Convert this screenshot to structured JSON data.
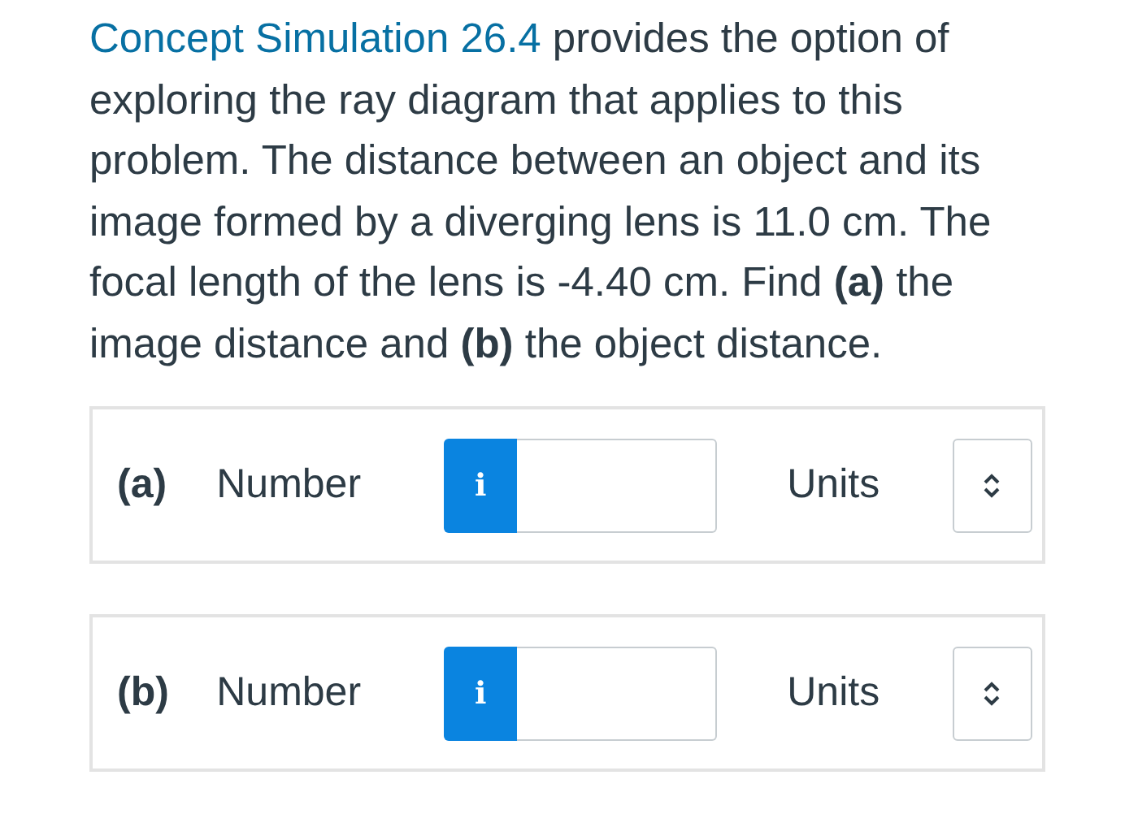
{
  "problem": {
    "link": "Concept Simulation 26.4",
    "text": " provides the option of exploring the ray diagram that applies to this problem. The distance between an object and its image formed by a diverging lens is 11.0 cm. The focal length of the lens is -4.40 cm. Find **(a)** the image distance and **(b)** the object distance."
  },
  "answers": [
    {
      "part": "(a)",
      "field_label": "Number",
      "info": "i",
      "units_label": "Units"
    },
    {
      "part": "(b)",
      "field_label": "Number",
      "info": "i",
      "units_label": "Units"
    }
  ]
}
